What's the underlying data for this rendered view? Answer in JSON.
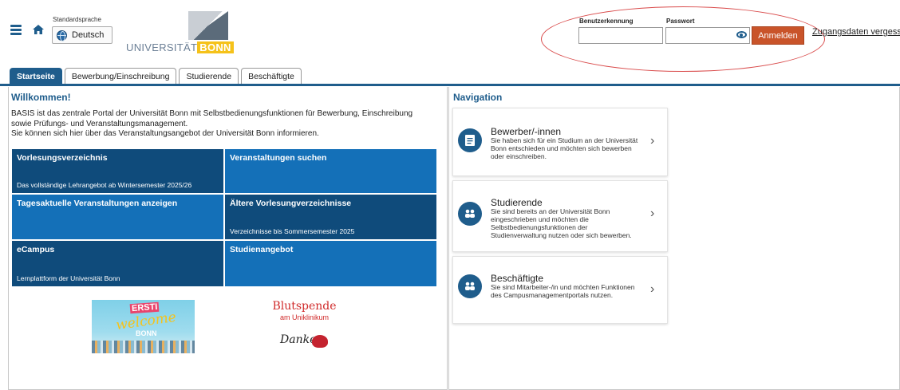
{
  "header": {
    "language_label": "Standardsprache",
    "language_value": "Deutsch",
    "logo_text": "UNIVERSITÄT",
    "logo_bonn": "BONN",
    "username_label": "Benutzerkennung",
    "password_label": "Passwort",
    "username_value": "",
    "password_value": "",
    "login_button": "Anmelden",
    "forgot_link": "Zugangsdaten vergesse"
  },
  "tabs": [
    {
      "label": "Startseite",
      "active": true
    },
    {
      "label": "Bewerbung/Einschreibung",
      "active": false
    },
    {
      "label": "Studierende",
      "active": false
    },
    {
      "label": "Beschäftigte",
      "active": false
    }
  ],
  "welcome": {
    "title": "Willkommen!",
    "line1": "BASIS ist das zentrale Portal der Universität Bonn mit Selbstbedienungsfunktionen für Bewerbung, Einschreibung",
    "line2": "sowie Prüfungs- und Veranstaltungsmanagement.",
    "line3": "Sie können sich hier über das Veranstaltungsangebot der Universität Bonn informieren."
  },
  "tiles": [
    {
      "title": "Vorlesungsverzeichnis",
      "sub": "Das vollständige Lehrangebot ab Wintersemester 2025/26"
    },
    {
      "title": "Veranstaltungen suchen",
      "sub": ""
    },
    {
      "title": "Tagesaktuelle Veranstaltungen anzeigen",
      "sub": ""
    },
    {
      "title": "Ältere Vorlesungverzeichnisse",
      "sub": "Verzeichnisse bis Sommersemester 2025"
    },
    {
      "title": "eCampus",
      "sub": "Lernplattform der Universität Bonn"
    },
    {
      "title": "Studienangebot",
      "sub": ""
    }
  ],
  "banners": {
    "welcome_erst": "ERSTI",
    "welcome_script": "welcome",
    "welcome_bonn": "BONN",
    "blut_title": "Blutspende",
    "blut_sub": "am Uniklinikum",
    "blut_danke": "Danke"
  },
  "navigation": {
    "title": "Navigation",
    "cards": [
      {
        "title": "Bewerber/-innen",
        "desc": "Sie haben sich für ein Studium an der Universität Bonn entschieden und möchten sich bewerben oder einschreiben."
      },
      {
        "title": "Studierende",
        "desc": "Sie sind bereits an der Universität Bonn eingeschrieben und möchten die Selbstbedienungsfunktionen der Studienverwaltung nutzen oder sich bewerben."
      },
      {
        "title": "Beschäftigte",
        "desc": "Sie sind Mitarbeiter-/in und möchten Funktionen des Campusmanagementportals nutzen."
      }
    ],
    "chevron": "›"
  }
}
